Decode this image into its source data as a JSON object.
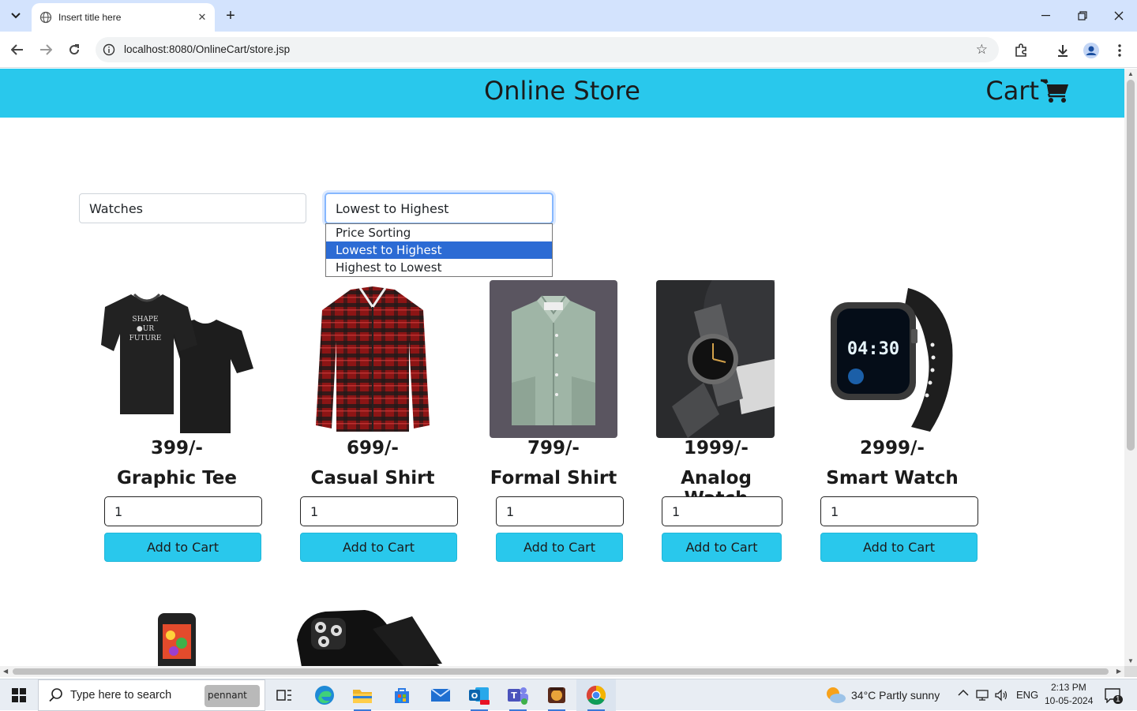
{
  "browser": {
    "tab_title": "Insert title here",
    "url": "localhost:8080/OnlineCart/store.jsp"
  },
  "site": {
    "title": "Online Store",
    "cart_label": "Cart"
  },
  "filters": {
    "category_value": "Watches",
    "sort_value": "Lowest to Highest",
    "sort_options": [
      "Price Sorting",
      "Lowest to Highest",
      "Highest to Lowest"
    ],
    "sort_selected_index": 1
  },
  "products": [
    {
      "price": "399/-",
      "name": "Graphic Tee",
      "qty": "1",
      "button": "Add to Cart",
      "icon": "tshirt-image"
    },
    {
      "price": "699/-",
      "name": "Casual Shirt",
      "qty": "1",
      "button": "Add to Cart",
      "icon": "plaid-shirt-image"
    },
    {
      "price": "799/-",
      "name": "Formal Shirt",
      "qty": "1",
      "button": "Add to Cart",
      "icon": "formal-shirt-image"
    },
    {
      "price": "1999/-",
      "name": "Analog Watch",
      "qty": "1",
      "button": "Add to Cart",
      "icon": "analog-watch-image"
    },
    {
      "price": "2999/-",
      "name": "Smart Watch",
      "qty": "1",
      "button": "Add to Cart",
      "icon": "smart-watch-image"
    }
  ],
  "partial_products": [
    {
      "icon": "feature-phone-image"
    },
    {
      "icon": "phone-case-image"
    }
  ],
  "smartwatch_display": {
    "time": "04:30"
  },
  "taskbar": {
    "search_placeholder": "Type here to search",
    "search_badge": "pennant",
    "weather": "34°C  Partly sunny",
    "language": "ENG",
    "time": "2:13 PM",
    "date": "10-05-2024",
    "notifications": "1"
  },
  "colors": {
    "header": "#29c8ec",
    "button": "#29c8ec",
    "selected_option": "#2c6bd4"
  }
}
